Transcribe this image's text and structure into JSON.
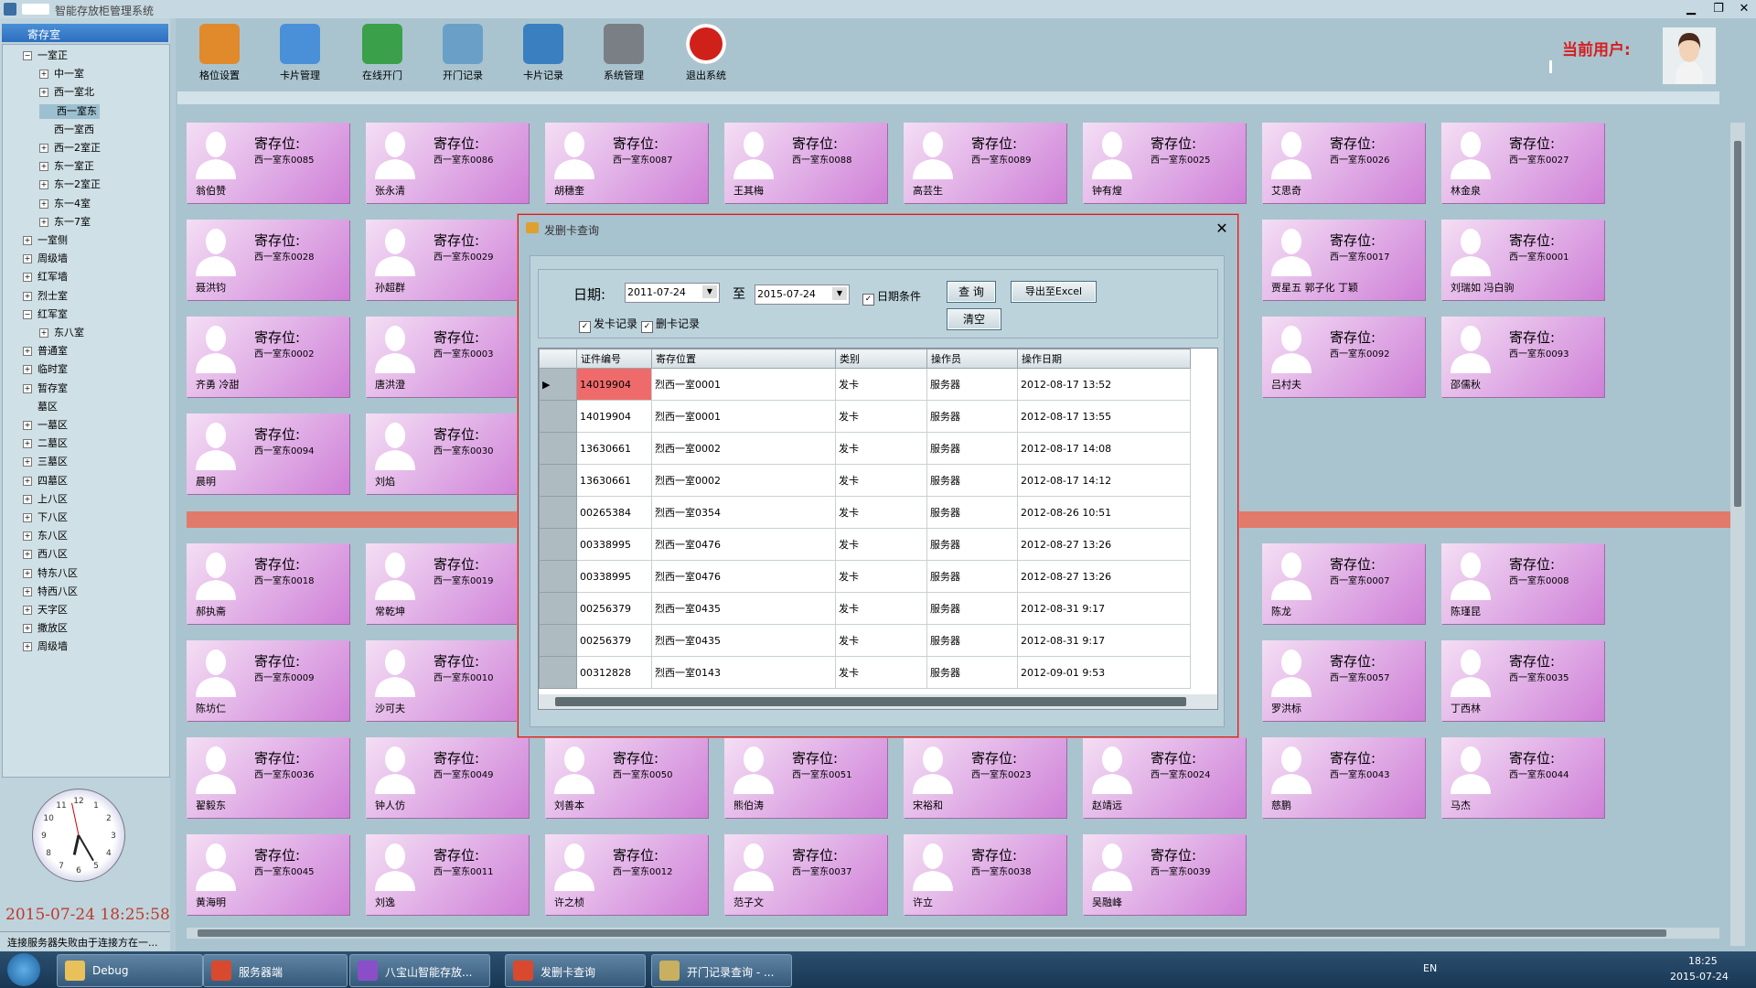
{
  "window": {
    "title": "智能存放柜管理系统",
    "min_label": "▁",
    "restore_label": "❐",
    "close_label": "✕"
  },
  "tree": {
    "header": "寄存室",
    "nodes": [
      {
        "label": "一室正",
        "level": 1,
        "sym": "−"
      },
      {
        "label": "中一室",
        "level": 2,
        "sym": "+"
      },
      {
        "label": "西一室北",
        "level": 2,
        "sym": "+"
      },
      {
        "label": "西一室东",
        "level": 2,
        "sym": "",
        "selected": true
      },
      {
        "label": "西一室西",
        "level": 2,
        "sym": ""
      },
      {
        "label": "西一2室正",
        "level": 2,
        "sym": "+"
      },
      {
        "label": "东一室正",
        "level": 2,
        "sym": "+"
      },
      {
        "label": "东一2室正",
        "level": 2,
        "sym": "+"
      },
      {
        "label": "东一4室",
        "level": 2,
        "sym": "+"
      },
      {
        "label": "东一7室",
        "level": 2,
        "sym": "+"
      },
      {
        "label": "一室侧",
        "level": 1,
        "sym": "+"
      },
      {
        "label": "周级墙",
        "level": 1,
        "sym": "+"
      },
      {
        "label": "红军墙",
        "level": 1,
        "sym": "+"
      },
      {
        "label": "烈士室",
        "level": 1,
        "sym": "+"
      },
      {
        "label": "红军室",
        "level": 1,
        "sym": "−"
      },
      {
        "label": "东八室",
        "level": 2,
        "sym": "+"
      },
      {
        "label": "普通室",
        "level": 1,
        "sym": "+"
      },
      {
        "label": "临时室",
        "level": 1,
        "sym": "+"
      },
      {
        "label": "暂存室",
        "level": 1,
        "sym": "+"
      },
      {
        "label": "墓区",
        "level": 1,
        "sym": ""
      },
      {
        "label": "一墓区",
        "level": 1,
        "sym": "+"
      },
      {
        "label": "二墓区",
        "level": 1,
        "sym": "+"
      },
      {
        "label": "三墓区",
        "level": 1,
        "sym": "+"
      },
      {
        "label": "四墓区",
        "level": 1,
        "sym": "+"
      },
      {
        "label": "上八区",
        "level": 1,
        "sym": "+"
      },
      {
        "label": "下八区",
        "level": 1,
        "sym": "+"
      },
      {
        "label": "东八区",
        "level": 1,
        "sym": "+"
      },
      {
        "label": "西八区",
        "level": 1,
        "sym": "+"
      },
      {
        "label": "特东八区",
        "level": 1,
        "sym": "+"
      },
      {
        "label": "特西八区",
        "level": 1,
        "sym": "+"
      },
      {
        "label": "天字区",
        "level": 1,
        "sym": "+"
      },
      {
        "label": "撒放区",
        "level": 1,
        "sym": "+"
      },
      {
        "label": "周级墙",
        "level": 1,
        "sym": "+"
      }
    ]
  },
  "clock": {
    "hour": 6,
    "minute": 25,
    "second": 58
  },
  "datetime": "2015-07-24 18:25:58",
  "status": "连接服务器失败由于连接方在一...",
  "toolbar": [
    {
      "label": "格位设置",
      "icon": "cabinet-add-icon",
      "color": "#e08a2c"
    },
    {
      "label": "卡片管理",
      "icon": "card-icon",
      "color": "#4a90d9"
    },
    {
      "label": "在线开门",
      "icon": "globe-icon",
      "color": "#3aa04a"
    },
    {
      "label": "开门记录",
      "icon": "document-search-icon",
      "color": "#6aa0c8"
    },
    {
      "label": "卡片记录",
      "icon": "magnifier-icon",
      "color": "#3a7fc0"
    },
    {
      "label": "系统管理",
      "icon": "tools-icon",
      "color": "#7a7f86"
    },
    {
      "label": "退出系统",
      "icon": "power-icon",
      "color": "#d0201a"
    }
  ],
  "current_user_label": "当前用户:",
  "cell_title": "寄存位:",
  "cells": [
    {
      "code": "西一室东0085",
      "name": "翁伯赞"
    },
    {
      "code": "西一室东0086",
      "name": "张永清"
    },
    {
      "code": "西一室东0087",
      "name": "胡穗奎"
    },
    {
      "code": "西一室东0088",
      "name": "王其梅"
    },
    {
      "code": "西一室东0089",
      "name": "高芸生"
    },
    {
      "code": "西一室东0025",
      "name": "钟有煌"
    },
    {
      "code": "西一室东0026",
      "name": "艾思奇"
    },
    {
      "code": "西一室东0027",
      "name": "林金泉"
    },
    {
      "code": "西一室东0028",
      "name": "聂洪钧"
    },
    {
      "code": "西一室东0029",
      "name": "孙超群"
    },
    {
      "code": "西一室东0017",
      "name": "贾星五  郭子化  丁颖"
    },
    {
      "code": "西一室东0001",
      "name": "刘瑞如  冯白驹"
    },
    {
      "code": "西一室东0002",
      "name": "齐勇  冷甜"
    },
    {
      "code": "西一室东0003",
      "name": "唐洪澄"
    },
    {
      "code": "西一室东0092",
      "name": "吕村夫"
    },
    {
      "code": "西一室东0093",
      "name": "邵儒秋"
    },
    {
      "code": "西一室东0094",
      "name": "晨明"
    },
    {
      "code": "西一室东0030",
      "name": "刘焰"
    },
    {
      "code": "西一室东0018",
      "name": "郝执斋"
    },
    {
      "code": "西一室东0019",
      "name": "常乾坤"
    },
    {
      "code": "西一室东0007",
      "name": "陈龙"
    },
    {
      "code": "西一室东0008",
      "name": "陈瑾昆"
    },
    {
      "code": "西一室东0009",
      "name": "陈坊仁"
    },
    {
      "code": "西一室东0010",
      "name": "沙可夫"
    },
    {
      "code": "西一室东0057",
      "name": "罗洪标"
    },
    {
      "code": "西一室东0035",
      "name": "丁西林"
    },
    {
      "code": "西一室东0036",
      "name": "翟毅东"
    },
    {
      "code": "西一室东0049",
      "name": "钟人仿"
    },
    {
      "code": "西一室东0050",
      "name": "刘善本"
    },
    {
      "code": "西一室东0051",
      "name": "熊伯涛"
    },
    {
      "code": "西一室东0023",
      "name": "宋裕和"
    },
    {
      "code": "西一室东0024",
      "name": "赵靖远"
    },
    {
      "code": "西一室东0043",
      "name": "慈鹏"
    },
    {
      "code": "西一室东0044",
      "name": "马杰"
    },
    {
      "code": "西一室东0045",
      "name": "黄海明"
    },
    {
      "code": "西一室东0011",
      "name": "刘逸"
    },
    {
      "code": "西一室东0012",
      "name": "许之桢"
    },
    {
      "code": "西一室东0037",
      "name": "范子文"
    },
    {
      "code": "西一室东0038",
      "name": "许立"
    },
    {
      "code": "西一室东0039",
      "name": "吴融峰"
    }
  ],
  "dialog": {
    "title": "发删卡查询",
    "close_label": "✕",
    "date_label": "日期:",
    "date_from": "2011-07-24",
    "to_label": "至",
    "date_to": "2015-07-24",
    "date_cond_label": "日期条件",
    "issue_label": "发卡记录",
    "delete_label": "删卡记录",
    "query_label": "查 询",
    "export_label": "导出至Excel",
    "clear_label": "清空",
    "columns": [
      "证件编号",
      "寄存位置",
      "类别",
      "操作员",
      "操作日期"
    ],
    "rows": [
      [
        "14019904",
        "烈西一室0001",
        "发卡",
        "服务器",
        "2012-08-17 13:52"
      ],
      [
        "14019904",
        "烈西一室0001",
        "发卡",
        "服务器",
        "2012-08-17 13:55"
      ],
      [
        "13630661",
        "烈西一室0002",
        "发卡",
        "服务器",
        "2012-08-17 14:08"
      ],
      [
        "13630661",
        "烈西一室0002",
        "发卡",
        "服务器",
        "2012-08-17 14:12"
      ],
      [
        "00265384",
        "烈西一室0354",
        "发卡",
        "服务器",
        "2012-08-26 10:51"
      ],
      [
        "00338995",
        "烈西一室0476",
        "发卡",
        "服务器",
        "2012-08-27 13:26"
      ],
      [
        "00338995",
        "烈西一室0476",
        "发卡",
        "服务器",
        "2012-08-27 13:26"
      ],
      [
        "00256379",
        "烈西一室0435",
        "发卡",
        "服务器",
        "2012-08-31 9:17"
      ],
      [
        "00256379",
        "烈西一室0435",
        "发卡",
        "服务器",
        "2012-08-31 9:17"
      ],
      [
        "00312828",
        "烈西一室0143",
        "发卡",
        "服务器",
        "2012-09-01 9:53"
      ]
    ]
  },
  "taskbar": [
    {
      "label": "Debug",
      "color": "#e8c15a"
    },
    {
      "label": "服务器端",
      "color": "#d9492e"
    },
    {
      "label": "八宝山智能存放...",
      "color": "#8a4fc8"
    },
    {
      "label": "发删卡查询",
      "color": "#d9492e"
    },
    {
      "label": "开门记录查询 - ...",
      "color": "#c8b060"
    }
  ],
  "tray": {
    "lang": "EN",
    "time": "18:25",
    "date": "2015-07-24"
  }
}
